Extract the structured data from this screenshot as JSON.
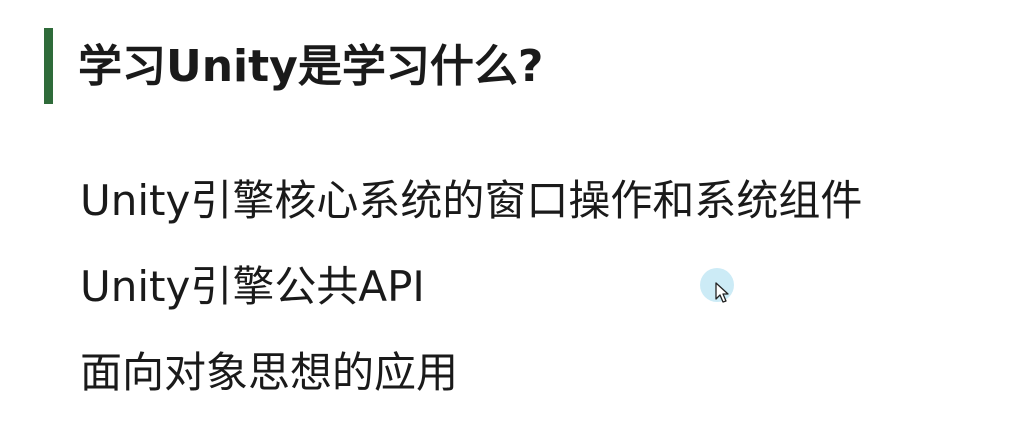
{
  "slide": {
    "title": "学习Unity是学习什么?",
    "accent_color": "#2f6b3a",
    "bullets": [
      "Unity引擎核心系统的窗口操作和系统组件",
      "Unity引擎公共API",
      "面向对象思想的应用"
    ]
  },
  "cursor": {
    "icon": "mouse-pointer-icon",
    "highlight_color": "#bfe6f4"
  }
}
